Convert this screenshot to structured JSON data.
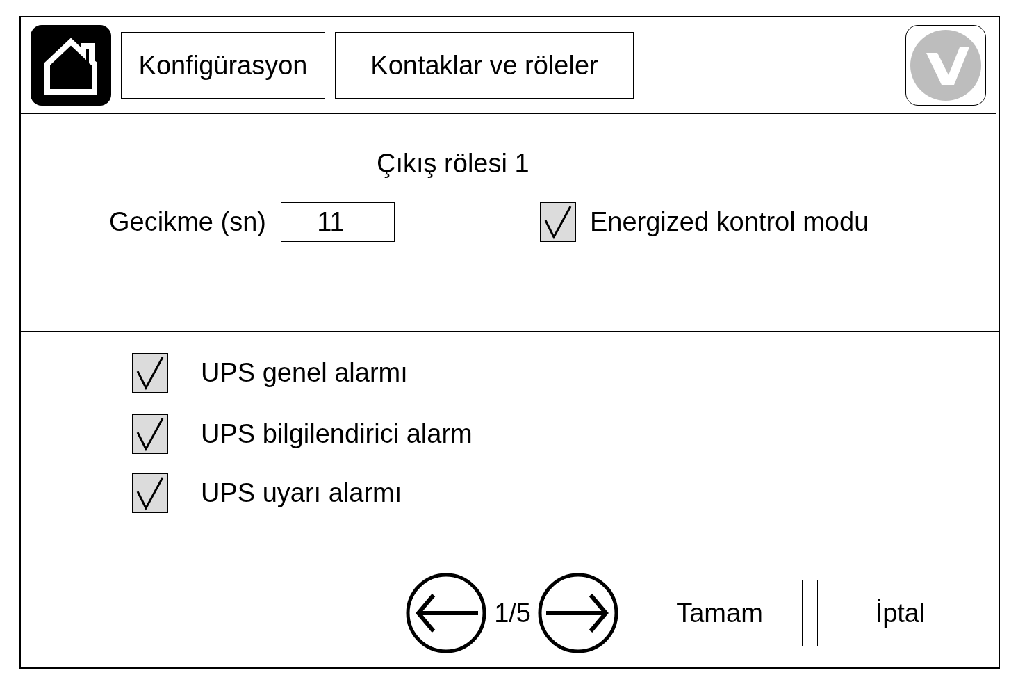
{
  "header": {
    "tabs": [
      {
        "label": "Konfigürasyon"
      },
      {
        "label": "Kontaklar ve röleler"
      }
    ]
  },
  "relay": {
    "title": "Çıkış rölesi 1",
    "delay_label": "Gecikme (sn)",
    "delay_value": "11",
    "energized": {
      "label": "Energized kontrol modu",
      "checked": true
    }
  },
  "alarms": [
    {
      "label": "UPS genel alarmı",
      "checked": true
    },
    {
      "label": "UPS bilgilendirici alarm",
      "checked": true
    },
    {
      "label": "UPS uyarı alarmı",
      "checked": true
    }
  ],
  "footer": {
    "page": "1/5",
    "buttons": [
      "Tamam",
      "İptal"
    ]
  }
}
